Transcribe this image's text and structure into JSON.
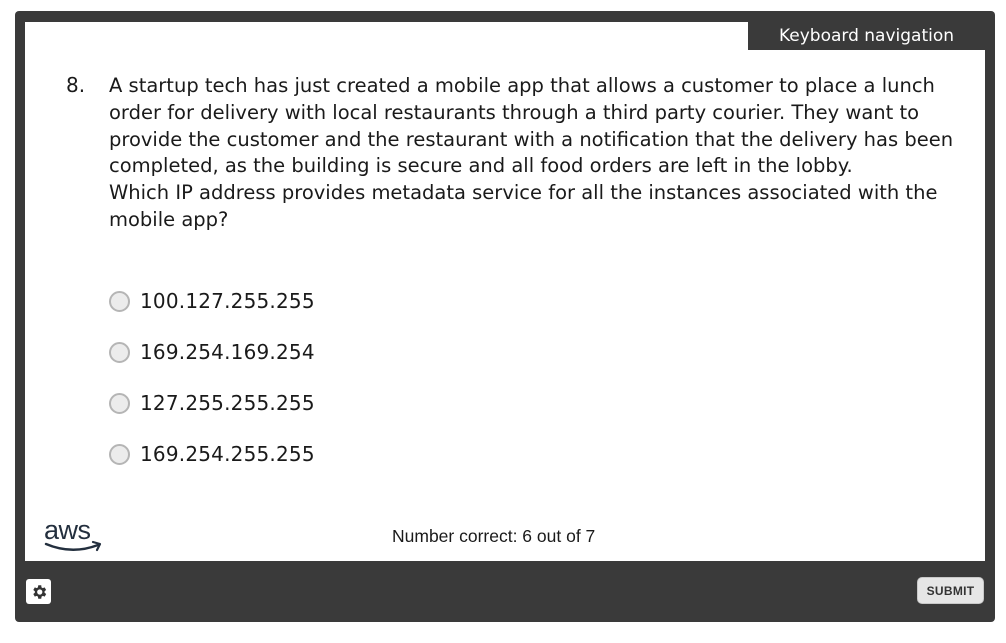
{
  "header": {
    "keyboard_navigation": "Keyboard navigation"
  },
  "question": {
    "number": "8.",
    "lines": [
      "A startup tech has just created a mobile app that allows a customer to place a lunch order for delivery with local restaurants through a third party courier. They want to provide the customer and the restaurant with a notification that the delivery has been completed, as the building is secure and all food orders are left in the lobby.",
      "Which IP address provides metadata service for all the instances associated with the mobile app?"
    ]
  },
  "options": [
    {
      "label": "100.127.255.255",
      "selected": false
    },
    {
      "label": "169.254.169.254",
      "selected": false
    },
    {
      "label": "127.255.255.255",
      "selected": false
    },
    {
      "label": "169.254.255.255",
      "selected": false
    }
  ],
  "logo": {
    "text": "aws",
    "icon": "aws-logo"
  },
  "footer": {
    "score": "Number correct: 6 out of 7",
    "settings_icon": "gear-icon",
    "submit_label": "SUBMIT"
  },
  "colors": {
    "frame": "#3a3a3a",
    "panel": "#ffffff",
    "logo_dark": "#232f3e"
  }
}
